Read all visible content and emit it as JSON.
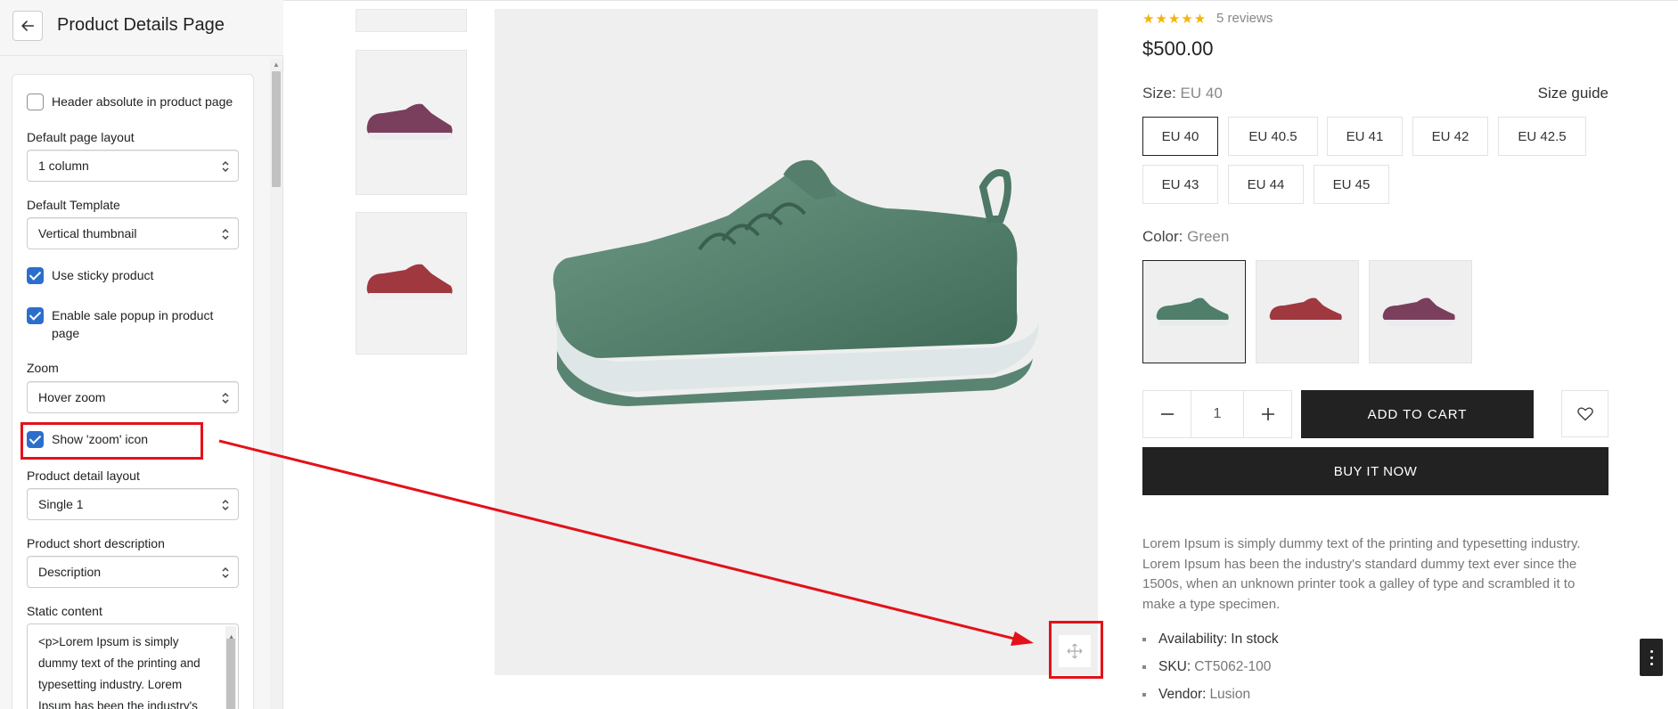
{
  "header": {
    "title": "Product Details Page"
  },
  "settings": {
    "header_absolute": {
      "label": "Header absolute in product page",
      "checked": false
    },
    "default_page_layout": {
      "label": "Default page layout",
      "value": "1 column"
    },
    "default_template": {
      "label": "Default Template",
      "value": "Vertical thumbnail"
    },
    "use_sticky": {
      "label": "Use sticky product",
      "checked": true
    },
    "sale_popup": {
      "label": "Enable sale popup in product page",
      "checked": true
    },
    "zoom": {
      "label": "Zoom",
      "value": "Hover zoom"
    },
    "show_zoom_icon": {
      "label": "Show 'zoom' icon",
      "checked": true
    },
    "detail_layout": {
      "label": "Product detail layout",
      "value": "Single 1"
    },
    "short_description": {
      "label": "Product short description",
      "value": "Description"
    },
    "static_content": {
      "label": "Static content",
      "lines": [
        "<p>Lorem Ipsum is simply",
        "dummy text of the printing and",
        "typesetting industry. Lorem",
        "Ipsum has been the industry's"
      ]
    }
  },
  "product": {
    "reviews": "5 reviews",
    "price": "$500.00",
    "size": {
      "label": "Size:",
      "value": "EU 40",
      "guide": "Size guide",
      "options": [
        "EU 40",
        "EU 40.5",
        "EU 41",
        "EU 42",
        "EU 42.5",
        "EU 43",
        "EU 44",
        "EU 45"
      ]
    },
    "color": {
      "label": "Color:",
      "value": "Green"
    },
    "quantity": "1",
    "add_to_cart": "ADD TO CART",
    "buy_now": "BUY IT NOW",
    "description": "Lorem Ipsum is simply dummy text of the printing and typesetting industry. Lorem Ipsum has been the industry's standard dummy text ever since the 1500s, when an unknown printer took a galley of type and scrambled it to make a type specimen.",
    "availability": {
      "label": "Availability:",
      "value": "In stock"
    },
    "sku": {
      "label": "SKU:",
      "value": "CT5062-100"
    },
    "vendor": {
      "label": "Vendor:",
      "value": "Lusion"
    }
  },
  "colors": {
    "accent": "#2c6ecb",
    "highlight": "#e3111a",
    "dark": "#222222",
    "star": "#f5b30c"
  }
}
